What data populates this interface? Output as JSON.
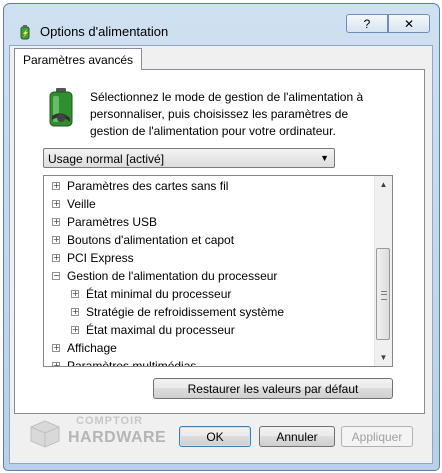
{
  "window": {
    "title": "Options d'alimentation",
    "help_label": "?",
    "close_label": "✕"
  },
  "tab": {
    "label": "Paramètres avancés"
  },
  "description": "Sélectionnez le mode de gestion de l'alimentation à personnaliser, puis choisissez les paramètres de gestion de l'alimentation pour votre ordinateur.",
  "plan_select": {
    "value": "Usage normal [activé]"
  },
  "tree": {
    "items": [
      {
        "label": "Paramètres des cartes sans fil",
        "expander": "+"
      },
      {
        "label": "Veille",
        "expander": "+"
      },
      {
        "label": "Paramètres USB",
        "expander": "+"
      },
      {
        "label": "Boutons d'alimentation et capot",
        "expander": "+"
      },
      {
        "label": "PCI Express",
        "expander": "+"
      },
      {
        "label": "Gestion de l'alimentation du processeur",
        "expander": "−"
      },
      {
        "label": "État minimal du processeur",
        "expander": "+"
      },
      {
        "label": "Stratégie de refroidissement système",
        "expander": "+"
      },
      {
        "label": "État maximal du processeur",
        "expander": "+"
      },
      {
        "label": "Affichage",
        "expander": "+"
      },
      {
        "label": "Paramètres multimédias",
        "expander": "+"
      }
    ]
  },
  "buttons": {
    "restore": "Restaurer les valeurs par défaut",
    "ok": "OK",
    "cancel": "Annuler",
    "apply": "Appliquer"
  },
  "watermark": {
    "line1": "COMPTOIR",
    "line2": "HARDWARE"
  },
  "icons": {
    "title": "power-options-icon",
    "battery": "battery-icon"
  }
}
